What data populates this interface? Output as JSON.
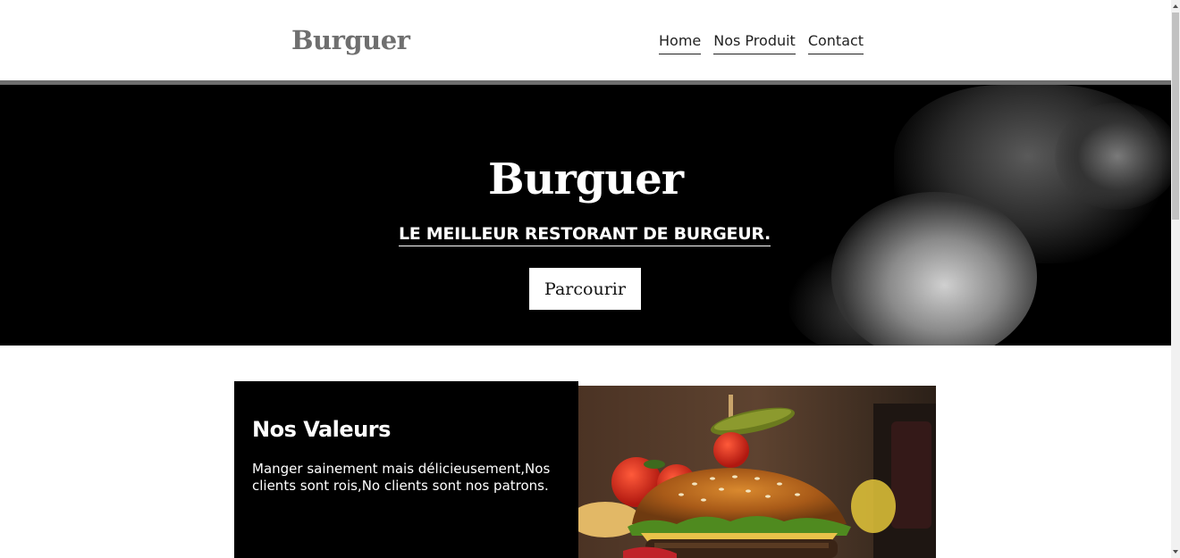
{
  "header": {
    "logo": "Burguer",
    "nav": [
      {
        "label": "Home"
      },
      {
        "label": "Nos Produit"
      },
      {
        "label": "Contact"
      }
    ]
  },
  "hero": {
    "title": "Burguer",
    "subtitle": "LE MEILLEUR RESTORANT DE BURGEUR.",
    "button": "Parcourir"
  },
  "values": {
    "title": "Nos Valeurs",
    "text": "Manger sainement mais délicieusement,Nos clients sont rois,No clients sont nos patrons."
  },
  "colors": {
    "header_bar": "#6e6e6e",
    "hero_bg": "#000000",
    "logo": "#6f6f6f"
  }
}
